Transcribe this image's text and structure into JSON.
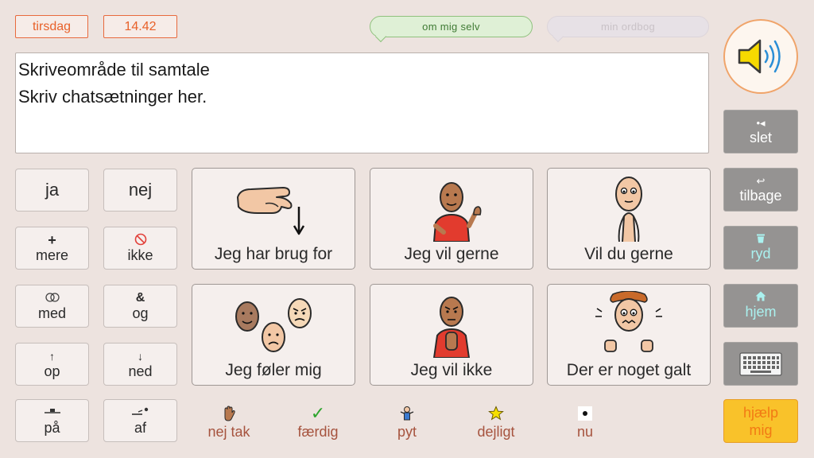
{
  "header": {
    "day": "tirsdag",
    "time": "14.42",
    "about_me": "om mig selv",
    "my_dictionary": "min ordbog"
  },
  "writing_area": {
    "line1": "Skriveområde til samtale",
    "line2": "Skriv chatsætninger her."
  },
  "icons": {
    "speak": "speaker-icon",
    "delete": "backspace-icon",
    "back": "undo-arrow-icon",
    "clear": "trash-icon",
    "home": "home-icon",
    "keyboard": "keyboard-icon"
  },
  "right_panel": {
    "delete_label": "slet",
    "back_label": "tilbage",
    "clear_label": "ryd",
    "home_label": "hjem",
    "help_line1": "hjælp",
    "help_line2": "mig"
  },
  "words": {
    "yes": "ja",
    "no": "nej",
    "more": "mere",
    "not": "ikke",
    "with": "med",
    "and": "og",
    "up": "op",
    "down": "ned",
    "on": "på",
    "off": "af"
  },
  "phrases": {
    "need": "Jeg har brug for",
    "want": "Jeg vil gerne",
    "would_you": "Vil du gerne",
    "feel": "Jeg føler mig",
    "dont_want": "Jeg vil ikke",
    "wrong": "Der er noget galt"
  },
  "quick": {
    "no_thanks": "nej tak",
    "done": "færdig",
    "whatever": "pyt",
    "lovely": "dejligt",
    "now": "nu"
  },
  "colors": {
    "background": "#ede3df",
    "accent_orange": "#e8612a",
    "grey_button": "#959392",
    "help_yellow": "#f9c22a",
    "quick_text": "#a6533e"
  }
}
